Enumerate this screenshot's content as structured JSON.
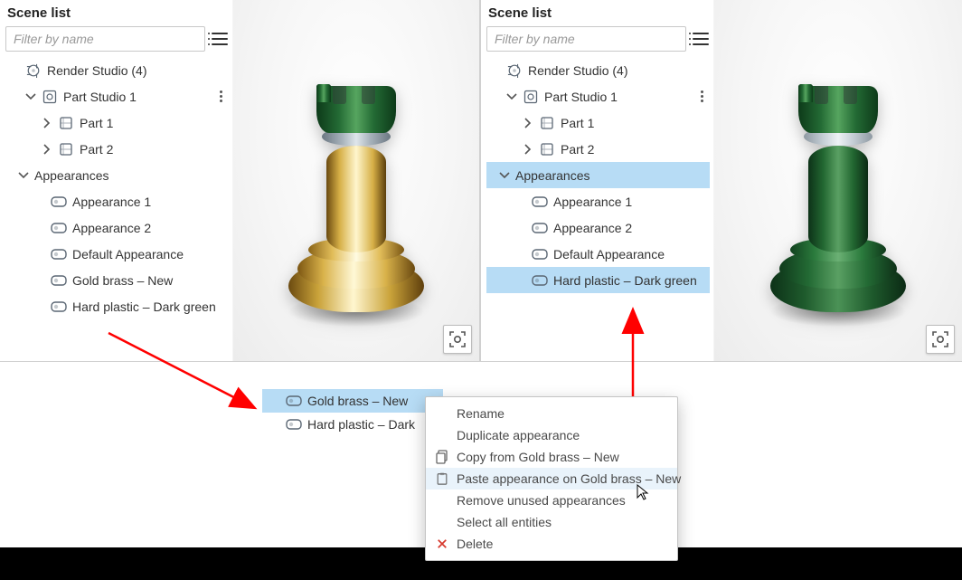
{
  "panel": {
    "title": "Scene list",
    "filter_placeholder": "Filter by name"
  },
  "treeLeft": {
    "root": "Render Studio (4)",
    "studio": "Part Studio 1",
    "part1": "Part 1",
    "part2": "Part 2",
    "appearances": "Appearances",
    "items": [
      "Appearance 1",
      "Appearance 2",
      "Default Appearance",
      "Gold brass – New",
      "Hard plastic – Dark green"
    ]
  },
  "treeRight": {
    "root": "Render Studio (4)",
    "studio": "Part Studio 1",
    "part1": "Part 1",
    "part2": "Part 2",
    "appearances": "Appearances",
    "items": [
      "Appearance 1",
      "Appearance 2",
      "Default Appearance",
      "Hard plastic – Dark green"
    ],
    "selected_index": 3
  },
  "floatTree": {
    "item_selected": "Gold brass – New",
    "item_other": "Hard plastic – Dark"
  },
  "contextMenu": {
    "rename": "Rename",
    "duplicate": "Duplicate appearance",
    "copy": "Copy from Gold brass – New",
    "paste": "Paste appearance on Gold brass – New",
    "remove": "Remove unused appearances",
    "selectAll": "Select all entities",
    "delete": "Delete"
  },
  "colors": {
    "arrow": "#ff0000",
    "selected": "#b7dcf5"
  }
}
